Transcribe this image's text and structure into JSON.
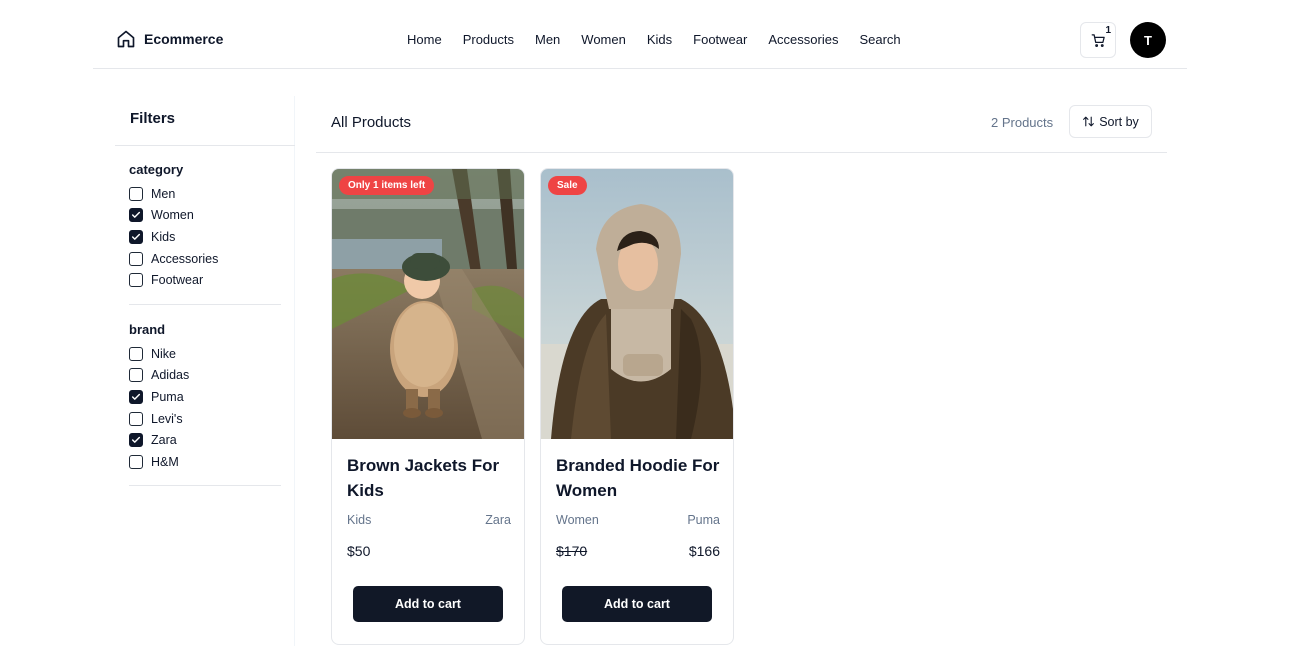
{
  "header": {
    "logo_text": "Ecommerce",
    "nav": [
      "Home",
      "Products",
      "Men",
      "Women",
      "Kids",
      "Footwear",
      "Accessories",
      "Search"
    ],
    "cart_count": "1",
    "avatar_initial": "T"
  },
  "sidebar": {
    "title": "Filters",
    "groups": [
      {
        "title": "category",
        "items": [
          {
            "label": "Men",
            "checked": false
          },
          {
            "label": "Women",
            "checked": true
          },
          {
            "label": "Kids",
            "checked": true
          },
          {
            "label": "Accessories",
            "checked": false
          },
          {
            "label": "Footwear",
            "checked": false
          }
        ]
      },
      {
        "title": "brand",
        "items": [
          {
            "label": "Nike",
            "checked": false
          },
          {
            "label": "Adidas",
            "checked": false
          },
          {
            "label": "Puma",
            "checked": true
          },
          {
            "label": "Levi's",
            "checked": false
          },
          {
            "label": "Zara",
            "checked": true
          },
          {
            "label": "H&M",
            "checked": false
          }
        ]
      }
    ]
  },
  "main": {
    "title": "All Products",
    "count_text": "2 Products",
    "sort_label": "Sort by",
    "products": [
      {
        "badge": "Only 1 items left",
        "title": "Brown Jackets For Kids",
        "category": "Kids",
        "brand": "Zara",
        "price": "$50",
        "old_price": "",
        "button": "Add to cart"
      },
      {
        "badge": "Sale",
        "title": "Branded Hoodie For Women",
        "category": "Women",
        "brand": "Puma",
        "price": "$166",
        "old_price": "$170",
        "button": "Add to cart"
      }
    ]
  },
  "colors": {
    "badge": "#ef4444",
    "button": "#111827",
    "muted_text": "#64748b"
  }
}
